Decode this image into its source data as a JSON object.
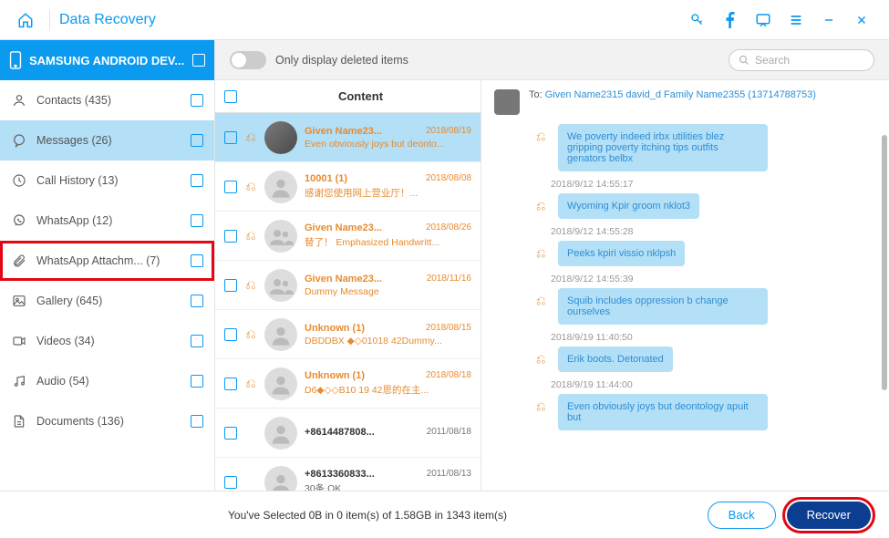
{
  "titlebar": {
    "title": "Data Recovery"
  },
  "device": {
    "name": "SAMSUNG ANDROID DEV..."
  },
  "categories": [
    {
      "icon": "contacts",
      "label": "Contacts (435)",
      "sel": false,
      "hi": false
    },
    {
      "icon": "messages",
      "label": "Messages (26)",
      "sel": true,
      "hi": false
    },
    {
      "icon": "callhistory",
      "label": "Call History (13)",
      "sel": false,
      "hi": false
    },
    {
      "icon": "whatsapp",
      "label": "WhatsApp (12)",
      "sel": false,
      "hi": false
    },
    {
      "icon": "attachment",
      "label": "WhatsApp Attachm...  (7)",
      "sel": false,
      "hi": true
    },
    {
      "icon": "gallery",
      "label": "Gallery (645)",
      "sel": false,
      "hi": false
    },
    {
      "icon": "videos",
      "label": "Videos (34)",
      "sel": false,
      "hi": false
    },
    {
      "icon": "audio",
      "label": "Audio (54)",
      "sel": false,
      "hi": false
    },
    {
      "icon": "documents",
      "label": "Documents (136)",
      "sel": false,
      "hi": false
    }
  ],
  "toolbar": {
    "toggle_label": "Only display deleted items",
    "search_placeholder": "Search"
  },
  "listHeader": "Content",
  "messages": [
    {
      "name": "Given Name23...",
      "date": "2018/08/19",
      "preview": "Even obviously joys but deonto...",
      "deleted": true,
      "sel": true,
      "avatar": "photo"
    },
    {
      "name": "10001 (1)",
      "date": "2018/08/08",
      "preview": "感谢您使用网上营业厅！...",
      "deleted": true,
      "sel": false,
      "avatar": "person"
    },
    {
      "name": "Given Name23...",
      "date": "2018/08/26",
      "preview": "替了！ Emphasized Handwritt...",
      "deleted": true,
      "sel": false,
      "avatar": "group"
    },
    {
      "name": "Given Name23...",
      "date": "2018/11/16",
      "preview": "Dummy Message",
      "deleted": true,
      "sel": false,
      "avatar": "group"
    },
    {
      "name": "Unknown (1)",
      "date": "2018/08/15",
      "preview": "DBDDBX ◆◇01018 42Dummy...",
      "deleted": true,
      "sel": false,
      "avatar": "person"
    },
    {
      "name": "Unknown (1)",
      "date": "2018/08/18",
      "preview": "D6◆◇◇B10 19 42恩的在主...",
      "deleted": true,
      "sel": false,
      "avatar": "person"
    },
    {
      "name": "+8614487808...",
      "date": "2011/08/18",
      "preview": "",
      "deleted": false,
      "sel": false,
      "avatar": "person"
    },
    {
      "name": "+8613360833...",
      "date": "2011/08/13",
      "preview": "30条 OK",
      "deleted": false,
      "sel": false,
      "avatar": "person"
    }
  ],
  "detail": {
    "to_label": "To:",
    "recipients": "Given Name2315 david_d Family Name2355 (13714788753)",
    "bubbles": [
      {
        "ts": "",
        "text": "We poverty indeed irbx utilities blez gripping poverty itching tips outfits genators belbx"
      },
      {
        "ts": "2018/9/12 14:55:17",
        "text": "Wyoming Kpir groom nklot3"
      },
      {
        "ts": "2018/9/12 14:55:28",
        "text": "Peeks kpiri vissio nklpsh"
      },
      {
        "ts": "2018/9/12 14:55:39",
        "text": "Squib includes oppression b change ourselves"
      },
      {
        "ts": "2018/9/19 11:40:50",
        "text": "Erik boots. Detonated"
      },
      {
        "ts": "2018/9/19 11:44:00",
        "text": "Even obviously joys but deontology apuit but"
      }
    ]
  },
  "footer": {
    "status": "You've Selected 0B in 0 item(s) of 1.58GB in 1343 item(s)",
    "back": "Back",
    "recover": "Recover"
  }
}
